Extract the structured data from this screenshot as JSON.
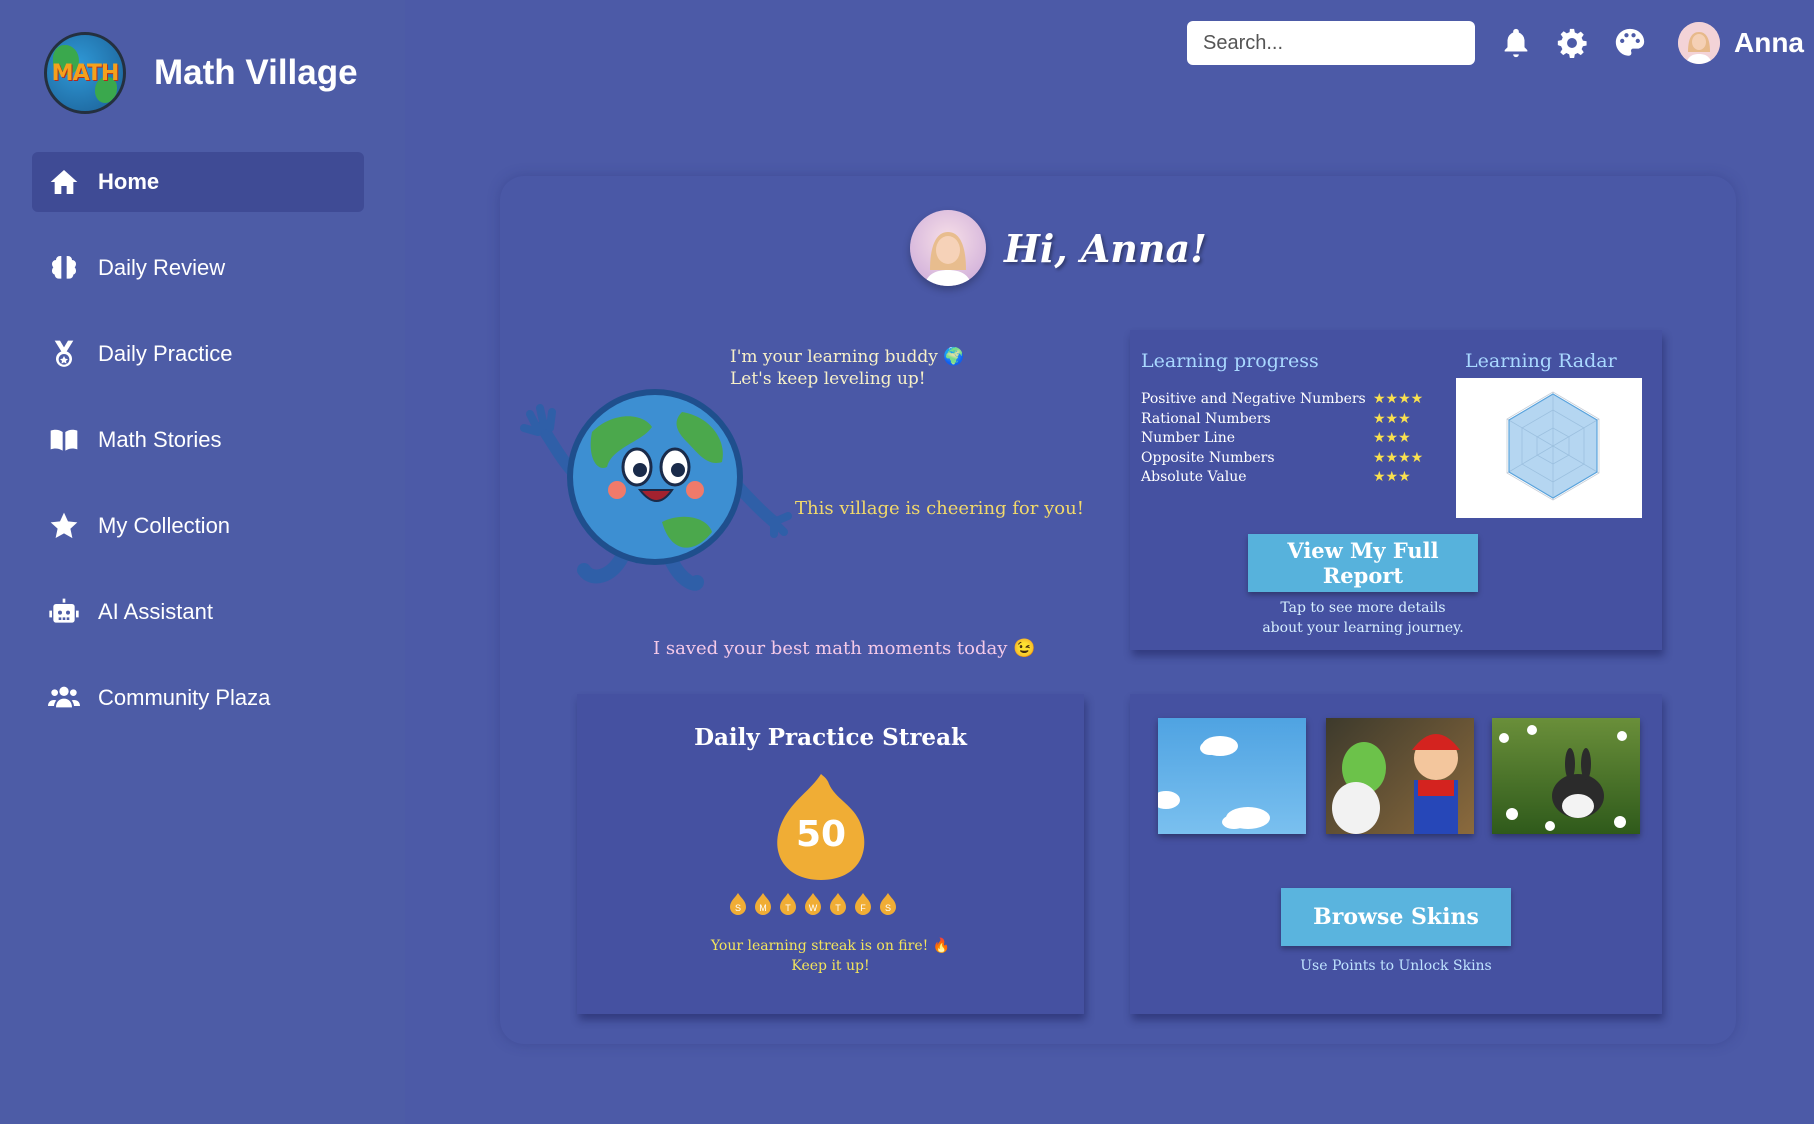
{
  "app": {
    "title": "Math Village",
    "logo_text": "MATH"
  },
  "sidebar": {
    "items": [
      {
        "label": "Home",
        "icon": "home-icon",
        "active": true
      },
      {
        "label": "Daily Review",
        "icon": "brain-icon"
      },
      {
        "label": "Daily Practice",
        "icon": "medal-icon"
      },
      {
        "label": "Math Stories",
        "icon": "book-icon"
      },
      {
        "label": "My Collection",
        "icon": "star-icon"
      },
      {
        "label": "AI Assistant",
        "icon": "robot-icon"
      },
      {
        "label": "Community Plaza",
        "icon": "users-icon"
      }
    ]
  },
  "header": {
    "search_placeholder": "Search...",
    "icons": [
      "bell-icon",
      "gear-icon",
      "palette-icon"
    ],
    "user_name": "Anna"
  },
  "greeting": {
    "text": "Hi, Anna!"
  },
  "buddy": {
    "line1": "I'm your learning buddy 🌍",
    "line2": "Let's keep leveling up!",
    "cheer": "This village is cheering for you!",
    "saved": "I saved your best math moments today 😉"
  },
  "progress": {
    "title": "Learning progress",
    "radar_title": "Learning Radar",
    "skills": [
      {
        "name": "Positive and Negative Numbers",
        "stars": "★★★★"
      },
      {
        "name": "Rational Numbers",
        "stars": "★★★"
      },
      {
        "name": "Number Line",
        "stars": "★★★"
      },
      {
        "name": "Opposite Numbers",
        "stars": "★★★★"
      },
      {
        "name": "Absolute Value",
        "stars": "★★★"
      }
    ],
    "report_button": "View My Full Report",
    "report_sub1": "Tap to see more details",
    "report_sub2": "about your learning journey."
  },
  "streak": {
    "title": "Daily Practice Streak",
    "count": "50",
    "days": [
      "S",
      "M",
      "T",
      "W",
      "T",
      "F",
      "S"
    ],
    "msg1": "Your learning streak is on fire! 🔥",
    "msg2": "Keep it up!"
  },
  "skins": {
    "items": [
      "sky-skin",
      "toys-skin",
      "bunny-skin"
    ],
    "button": "Browse Skins",
    "sub": "Use Points to Unlock Skins"
  },
  "colors": {
    "background": "#4c5aa7",
    "panel": "#4551a1",
    "active_nav": "#3f4b95",
    "button": "#57b2dc",
    "star": "#f9e04f",
    "flame": "#f0ad35"
  }
}
